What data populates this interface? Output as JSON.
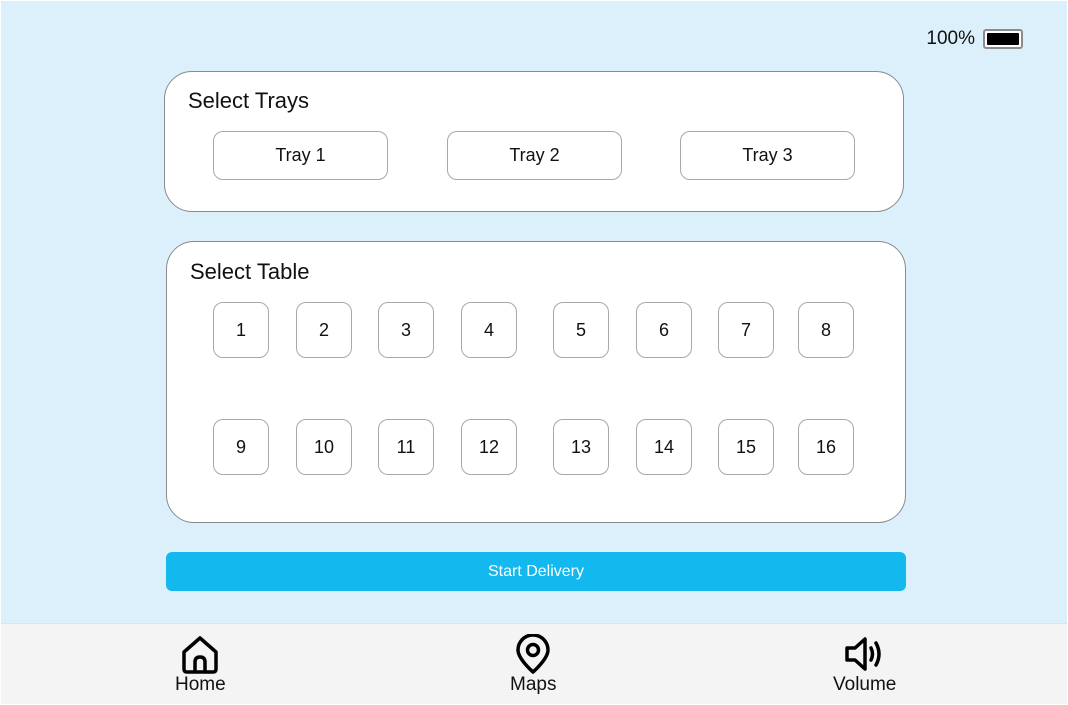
{
  "status": {
    "battery_text": "100%",
    "battery_level": 1.0
  },
  "trays": {
    "title": "Select Trays",
    "items": [
      "Tray 1",
      "Tray 2",
      "Tray 3"
    ]
  },
  "tables": {
    "title": "Select Table",
    "items": [
      "1",
      "2",
      "3",
      "4",
      "5",
      "6",
      "7",
      "8",
      "9",
      "10",
      "11",
      "12",
      "13",
      "14",
      "15",
      "16"
    ]
  },
  "start_button": {
    "label": "Start Delivery"
  },
  "nav": {
    "items": [
      {
        "label": "Home",
        "icon": "home-icon"
      },
      {
        "label": "Maps",
        "icon": "map-pin-icon"
      },
      {
        "label": "Volume",
        "icon": "volume-icon"
      }
    ]
  },
  "colors": {
    "background": "#dbf0fb",
    "accent": "#12b8ee",
    "nav_background": "#f4f4f4"
  }
}
